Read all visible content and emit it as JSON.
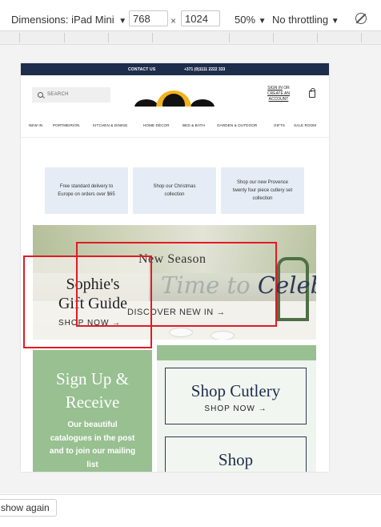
{
  "devtools": {
    "dimensions_label": "Dimensions: iPad Mini",
    "dropdown_caret": "▼",
    "width_value": "768",
    "times_symbol": "×",
    "height_value": "1024",
    "zoom_label": "50%",
    "throttling_label": "No throttling",
    "show_again_label": "show again"
  },
  "site": {
    "topbar": {
      "contact": "CONTACT US",
      "phone": "+371 (0)1111 2222 333"
    },
    "search_placeholder": "SEARCH",
    "account": {
      "line1": "SIGN IN",
      "or": "OR",
      "line2": "CREATE AN",
      "line3": "ACCOUNT"
    },
    "nav": [
      "NEW IN",
      "PORTMEIRION",
      "KITCHEN & DINING",
      "HOME DÉCOR",
      "BED & BATH",
      "GARDEN & OUTDOOR",
      "GIFTS",
      "SALE ROOM"
    ],
    "usps": [
      "Free standard delivery to Europe on orders over $65",
      "Shop our Christmas collection",
      "Shop our new Provence twenty four piece cutlery set collection"
    ],
    "hero": {
      "new_season": "New Season",
      "script_faint": "Time to ",
      "script": "Celebrate",
      "discover": "DISCOVER NEW IN →",
      "gift_title": "Sophie's Gift Guide",
      "shop_now": "SHOP NOW →"
    },
    "signup": {
      "title": "Sign Up & Receive",
      "body": "Our beautiful catalogues in the post and to join our mailing list"
    },
    "cutlery_card": {
      "title": "Shop Cutlery",
      "cta": "SHOP NOW →"
    },
    "shop_card": {
      "title": "Shop"
    }
  },
  "colors": {
    "navy": "#1e2d4b",
    "green": "#98c091",
    "usp_bg": "#e6ecf5",
    "highlight_red": "#e01b24",
    "logo_yellow": "#f2b21c"
  }
}
